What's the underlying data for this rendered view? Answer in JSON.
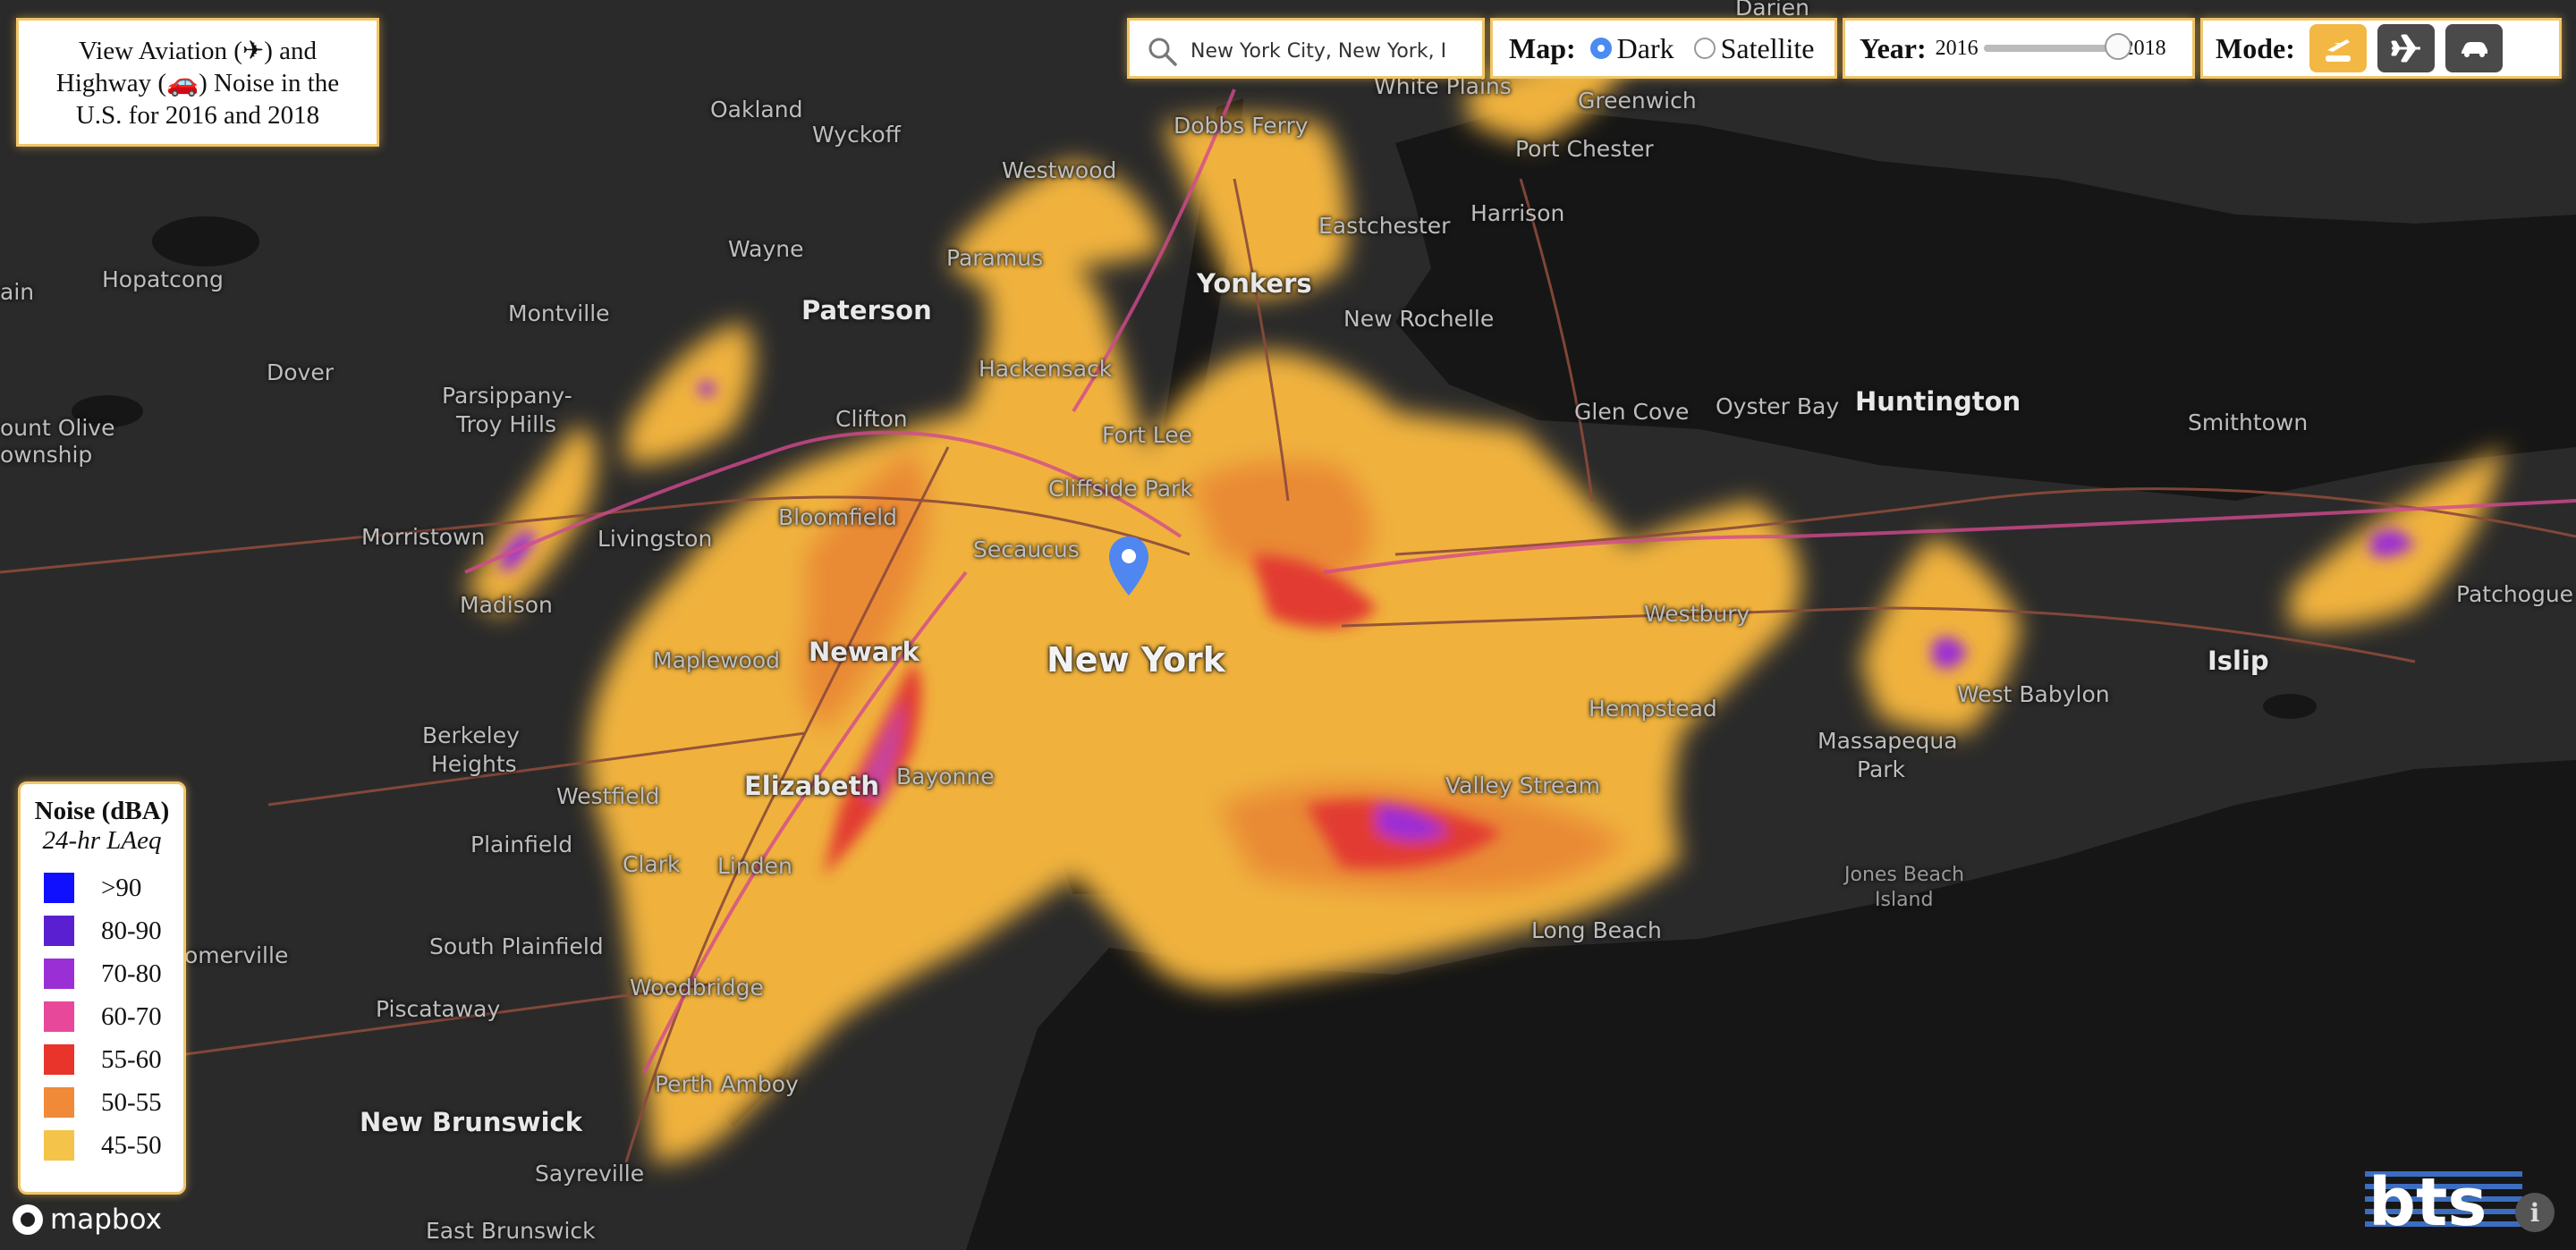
{
  "title_box": {
    "line1": "View Aviation (✈) and",
    "line2": "Highway (🚗) Noise in the",
    "line3": "U.S. for 2016 and 2018"
  },
  "search": {
    "value": "New York City, New York, I",
    "icon": "search-icon"
  },
  "map_style": {
    "label": "Map:",
    "options": [
      "Dark",
      "Satellite"
    ],
    "selected": "Dark"
  },
  "year": {
    "label": "Year:",
    "min": "2016",
    "max": "2018",
    "selected_fraction": 1.0
  },
  "mode": {
    "label": "Mode:",
    "buttons": [
      "aviation-and-highway-icon",
      "airplane-icon",
      "car-icon"
    ],
    "active": 0
  },
  "legend": {
    "title": "Noise (dBA)",
    "subtitle": "24-hr LAeq",
    "items": [
      {
        "label": ">90",
        "color": "#1010ff"
      },
      {
        "label": "80-90",
        "color": "#5a1fd0"
      },
      {
        "label": "70-80",
        "color": "#9b2fd6"
      },
      {
        "label": "60-70",
        "color": "#e8489a"
      },
      {
        "label": "55-60",
        "color": "#e8342a"
      },
      {
        "label": "50-55",
        "color": "#f08a38"
      },
      {
        "label": "45-50",
        "color": "#f4c44a"
      }
    ]
  },
  "places": {
    "darien": "Darien",
    "white_plains": "White Plains",
    "greenwich": "Greenwich",
    "oakland": "Oakland",
    "dobbs_ferry": "Dobbs Ferry",
    "port_chester": "Port Chester",
    "ryckoff": "Wyckoff",
    "westwood": "Westwood",
    "harrison": "Harrison",
    "eastchester": "Eastchester",
    "wayne": "Wayne",
    "paramus": "Paramus",
    "yonkers": "Yonkers",
    "hopatcong": "Hopatcong",
    "montville": "Montville",
    "paterson": "Paterson",
    "new_rochelle": "New Rochelle",
    "dover": "Dover",
    "hackensack": "Hackensack",
    "parsippany": "Parsippany-",
    "troy_hills": "Troy Hills",
    "clifton": "Clifton",
    "glen_cove": "Glen Cove",
    "oyster_bay": "Oyster Bay",
    "huntington": "Huntington",
    "smithtown": "Smithtown",
    "fort_lee": "Fort Lee",
    "mount_olive": "ount Olive",
    "township": "ownship",
    "cliffside_park": "Cliffside Park",
    "morristown": "Morristown",
    "livingston": "Livingston",
    "bloomfield": "Bloomfield",
    "secaucus": "Secaucus",
    "madison": "Madison",
    "patchogue": "Patchogue",
    "westbury": "Westbury",
    "new_york": "New York",
    "newark": "Newark",
    "maplewood": "Maplewood",
    "islip": "Islip",
    "west_babylon": "West Babylon",
    "hempstead": "Hempstead",
    "berkeley": "Berkeley",
    "heights": "Heights",
    "massapequa": "Massapequa",
    "park": "Park",
    "bayonne": "Bayonne",
    "elizabeth": "Elizabeth",
    "westfield": "Westfield",
    "valley_stream": "Valley Stream",
    "plainfield": "Plainfield",
    "clark": "Clark",
    "linden": "Linden",
    "jones_beach": "Jones Beach",
    "island": "Island",
    "long_beach": "Long Beach",
    "somerville": "omerville",
    "south_plainfield": "South Plainfield",
    "woodbridge": "Woodbridge",
    "piscataway": "Piscataway",
    "perth_amboy": "Perth Amboy",
    "new_brunswick": "New Brunswick",
    "sayreville": "Sayreville",
    "east_brunswick": "East Brunswick",
    "ain": "ain"
  },
  "attribution": {
    "mapbox": "mapbox",
    "bts": "bts"
  }
}
